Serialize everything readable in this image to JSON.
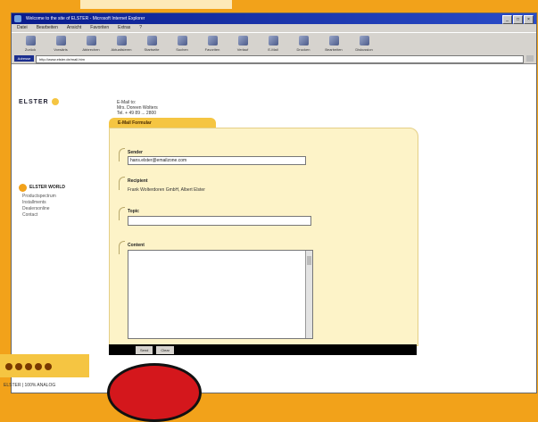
{
  "window": {
    "title": "Welcome to the site of ELSTER - Microsoft Internet Explorer",
    "buttons": [
      "_",
      "□",
      "×"
    ]
  },
  "menu": [
    "Datei",
    "Bearbeiten",
    "Ansicht",
    "Favoriten",
    "Extras",
    "?"
  ],
  "toolbar": [
    "Zurück",
    "Vorwärts",
    "Abbrechen",
    "Aktualisieren",
    "Startseite",
    "Suchen",
    "Favoriten",
    "Verlauf",
    "E-Mail",
    "Drucken",
    "Bearbeiten",
    "Diskussion"
  ],
  "address": {
    "label": "Adresse",
    "url": "http://www.elster.de/mail.htm"
  },
  "page": {
    "logo": "ELSTER",
    "contact_lines": [
      "E-Mail to:",
      "Mrs. Doreen Wolters",
      "Tel. + 49 89 ... 2800"
    ],
    "nav_title": "ELSTER WORLD",
    "nav_items": [
      "Productspectrum",
      "Installments",
      "Dealersonline",
      "Contact"
    ],
    "footer_text": "ELSTER | 100% ANALOG"
  },
  "form": {
    "tab_title": "E-Mail Formular",
    "sender_label": "Sender",
    "sender_value": "hans.elster@emailzone.com",
    "recipient_label": "Recipient",
    "recipient_value": "Frank Wolterdoren GmbH, Albert Elster",
    "topic_label": "Topic",
    "topic_value": "",
    "content_label": "Content",
    "send_label": "Send",
    "clear_label": "Clear"
  },
  "colors": {
    "frame": "#f2a21a",
    "panel": "#fdf3c8",
    "accent": "#f5c542"
  }
}
